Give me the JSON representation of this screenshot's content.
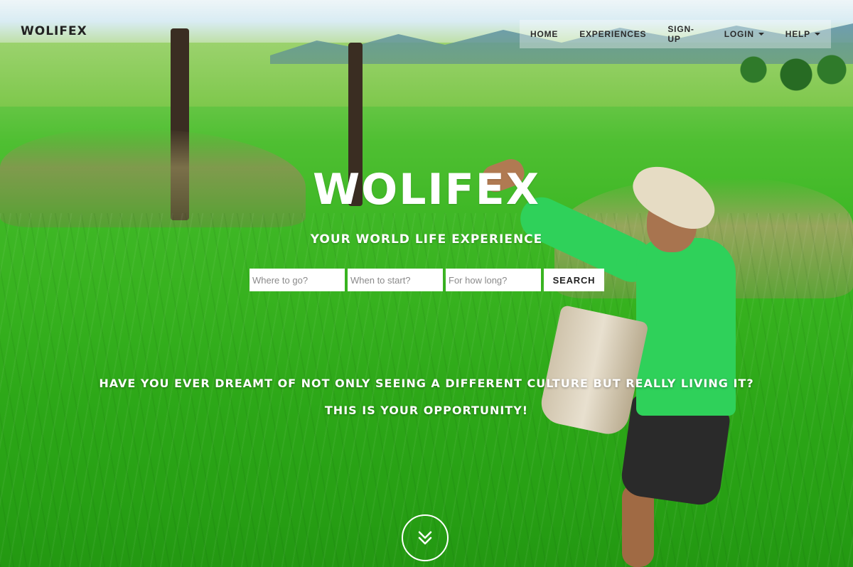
{
  "brand": {
    "name": "WOLIFEX"
  },
  "nav": {
    "items": [
      {
        "label": "HOME",
        "dropdown": false
      },
      {
        "label": "EXPERIENCES",
        "dropdown": false
      },
      {
        "label": "SIGN-UP",
        "dropdown": false
      },
      {
        "label": "LOGIN",
        "dropdown": true
      },
      {
        "label": "HELP",
        "dropdown": true
      }
    ]
  },
  "hero": {
    "title": "WOLIFEX",
    "subtitle": "YOUR WORLD LIFE EXPERIENCE",
    "tagline_line1": "HAVE YOU EVER DREAMT OF NOT ONLY SEEING A DIFFERENT CULTURE BUT REALLY LIVING IT?",
    "tagline_line2": "THIS IS YOUR OPPORTUNITY!"
  },
  "search": {
    "where_placeholder": "Where to go?",
    "when_placeholder": "When to start?",
    "duration_placeholder": "For how long?",
    "button_label": "SEARCH"
  },
  "icons": {
    "scroll": "double-chevron-down-icon",
    "dropdown": "caret-down-icon"
  },
  "colors": {
    "text_light": "#ffffff",
    "text_dark": "#222222",
    "background_green": "#37b21f"
  }
}
